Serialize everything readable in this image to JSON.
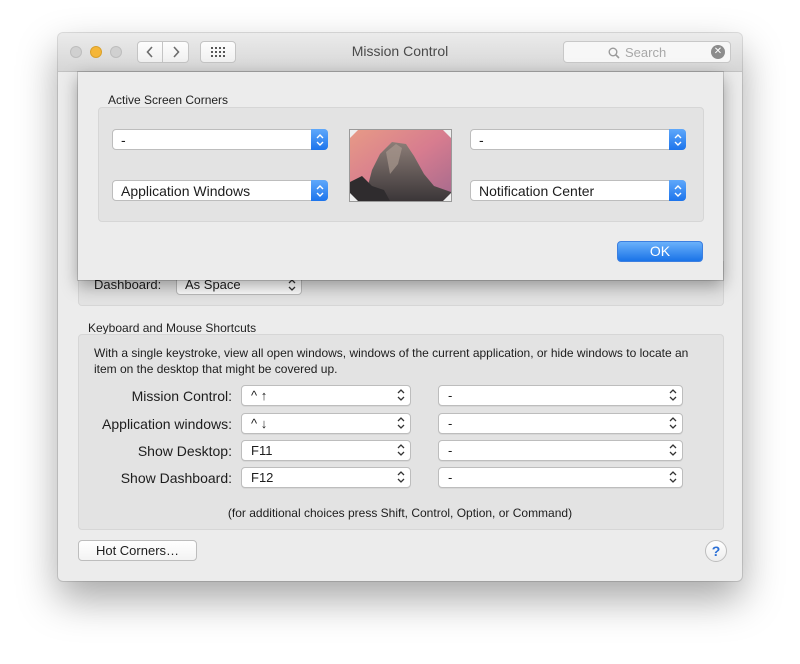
{
  "window": {
    "title": "Mission Control",
    "search_placeholder": "Search"
  },
  "background": {
    "dashboard_label": "Dashboard:",
    "dashboard_value": "As Space"
  },
  "shortcuts": {
    "group_label": "Keyboard and Mouse Shortcuts",
    "description": "With a single keystroke, view all open windows, windows of the current application, or hide windows to locate an item on the desktop that might be covered up.",
    "rows": [
      {
        "label": "Mission Control:",
        "key": "^ ↑",
        "mouse": "-"
      },
      {
        "label": "Application windows:",
        "key": "^ ↓",
        "mouse": "-"
      },
      {
        "label": "Show Desktop:",
        "key": "F11",
        "mouse": "-"
      },
      {
        "label": "Show Dashboard:",
        "key": "F12",
        "mouse": "-"
      }
    ],
    "footnote": "(for additional choices press Shift, Control, Option, or Command)"
  },
  "buttons": {
    "hot_corners": "Hot Corners…",
    "help": "?"
  },
  "sheet": {
    "group_label": "Active Screen Corners",
    "top_left": "-",
    "top_right": "-",
    "bottom_left": "Application Windows",
    "bottom_right": "Notification Center",
    "ok": "OK"
  },
  "colors": {
    "accent": "#1c74ec",
    "minimize": "#f5b638"
  }
}
